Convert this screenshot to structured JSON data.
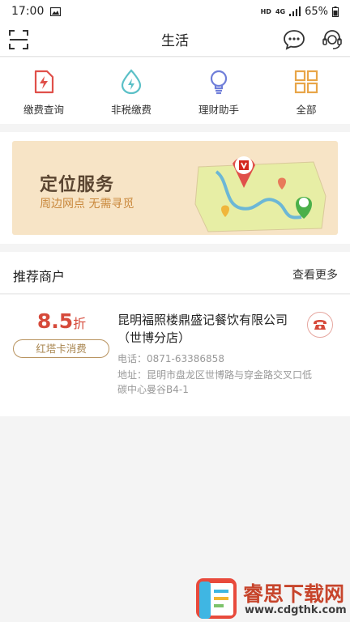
{
  "status_bar": {
    "time": "17:00",
    "hd": "HD",
    "network": "4G",
    "battery": "65%"
  },
  "nav": {
    "title": "生活"
  },
  "quick_actions": [
    {
      "label": "缴费查询",
      "icon": "bill-query-icon",
      "color": "#e0504a"
    },
    {
      "label": "非税缴费",
      "icon": "tax-payment-icon",
      "color": "#5bc0c7"
    },
    {
      "label": "理财助手",
      "icon": "lightbulb-icon",
      "color": "#6f7ed9"
    },
    {
      "label": "全部",
      "icon": "grid-icon",
      "color": "#e8a548"
    }
  ],
  "banner": {
    "title": "定位服务",
    "subtitle": "周边网点 无需寻觅"
  },
  "recommended": {
    "title": "推荐商户",
    "more_label": "查看更多"
  },
  "merchant": {
    "discount_value": "8.5",
    "discount_unit": "折",
    "card_tag": "红塔卡消费",
    "name": "昆明福照楼鼎盛记餐饮有限公司（世博分店）",
    "phone": "电话：0871-63386858",
    "address": "地址：昆明市盘龙区世博路与穿金路交叉口低碳中心曼谷B4-1"
  },
  "watermark": {
    "text": "睿思下载网",
    "url": "www.cdgthk.com"
  },
  "colors": {
    "accent_red": "#d64a3b",
    "banner_bg": "#f7e4c6",
    "tag_gold": "#a8854f"
  }
}
